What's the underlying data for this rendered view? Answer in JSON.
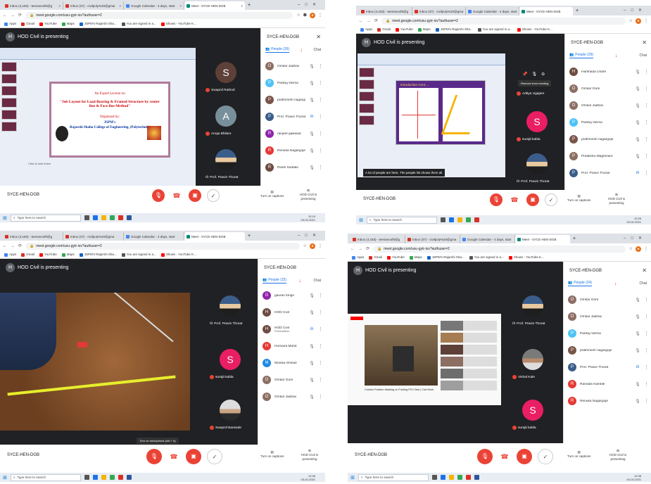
{
  "quadrants": [
    {
      "tabs": [
        "Inbox (4,183) - teenanoof5@g",
        "Inbox (37) - civilpoly%20@gmai",
        "Google Calendar - 4 days, start",
        "Meet - SYCE-HEN-DGB"
      ],
      "url": "meet.google.com/uxu-gytr-isv?authuser=2",
      "bookmarks": [
        "Apps",
        "Gmail",
        "YouTube",
        "Maps",
        "JSPM's Rajarshi Sha...",
        "You are signed in a...",
        "Shows - YouTube K..."
      ],
      "presenting": "HOD Civil is presenting",
      "presenter_initial": "H",
      "meeting_name": "SYCE-HEN-DGB",
      "people_count": "People (26)",
      "slide": {
        "line1": "An Expert Lecture on",
        "line2": "\"Job Layout for Load Bearing & Framed Structure by center line & Face line Method\"",
        "line3": "Organized by:",
        "line4": "JSPM's",
        "line5": "Rajarshi Shahu College of Engineering, (Polytechnic)",
        "notes": "Click to add notes"
      },
      "tiles": [
        {
          "initial": "S",
          "name": "Swapnil Rathod",
          "color": "#5d4037"
        },
        {
          "initial": "A",
          "name": "Anuja Bhilare",
          "color": "#78909c"
        },
        {
          "initial": "",
          "name": "Prof. Pravin Thorat",
          "color": "#3b5d8a"
        }
      ],
      "participants": [
        {
          "initial": "O",
          "name": "Omkar Jadhav",
          "color": "#8d6e63",
          "active": false
        },
        {
          "initial": "P",
          "name": "Pankaj Varma",
          "color": "#4fc3f7",
          "active": false
        },
        {
          "initial": "P",
          "name": "prathmesh nagargoje",
          "color": "#795548",
          "active": false
        },
        {
          "initial": "P",
          "name": "Prof. Pravin Thorat",
          "color": "#3b5d8a",
          "active": true
        },
        {
          "initial": "R",
          "name": "ranjeet gaikwad",
          "color": "#8e24aa",
          "active": false
        },
        {
          "initial": "R",
          "name": "Renuka Nagargoje",
          "color": "#e53935",
          "active": false
        },
        {
          "initial": "R",
          "name": "Rushi Sudake",
          "color": "#6d4c41",
          "active": false
        }
      ],
      "taskbar_search": "Type here to search",
      "clock": [
        "12:19",
        "03-02-2021"
      ]
    },
    {
      "tabs": [
        "Inbox (4,183) - teenanoof5@g",
        "Inbox (37) - civilpoly%20@gma",
        "Google Calendar - 4 days, start",
        "Meet - SYCE-HEN-DGB"
      ],
      "url": "meet.google.com/uxu-gytr-isv?authuser=2",
      "bookmarks": [
        "Apps",
        "Gmail",
        "YouTube",
        "Maps",
        "JSPM's Rajarshi Sha...",
        "You are signed in a...",
        "Shows - YouTube K..."
      ],
      "presenting": "HOD Civil is presenting",
      "presenter_initial": "H",
      "meeting_name": "SYCE-HEN-DGB",
      "people_count": "People (29)",
      "slide": {
        "title": "Introduction Cont...."
      },
      "overlay_text": "A lot of people are here. The people list shows them all.",
      "tooltip": "Remove from meeting",
      "tiles": [
        {
          "initial": "",
          "name": "Aditya Ugajare",
          "color": "#9e9e9e"
        },
        {
          "initial": "S",
          "name": "surajit kabla",
          "color": "#e91e63"
        },
        {
          "initial": "",
          "name": "Prof. Pravin Thorat",
          "color": "#3b5d8a"
        }
      ],
      "participants": [
        {
          "initial": "H",
          "name": "Harshada Undre",
          "color": "#6d4c41",
          "active": false
        },
        {
          "initial": "O",
          "name": "Omkar Gore",
          "color": "#8d6e63",
          "active": false
        },
        {
          "initial": "O",
          "name": "Omkar Jadhav",
          "color": "#8d6e63",
          "active": false
        },
        {
          "initial": "P",
          "name": "Pankaj Varma",
          "color": "#4fc3f7",
          "active": false
        },
        {
          "initial": "P",
          "name": "prathmesh nagargoje",
          "color": "#795548",
          "active": false
        },
        {
          "initial": "P",
          "name": "Pratiksha Waghmare",
          "color": "#8d6e63",
          "active": false
        },
        {
          "initial": "P",
          "name": "Prof. Pravin Thorat",
          "color": "#3b5d8a",
          "active": true
        }
      ],
      "taskbar_search": "Type here to search",
      "clock": [
        "12:26",
        "03-02-2021"
      ]
    },
    {
      "tabs": [
        "Inbox (4,183) - teenanoof5@g",
        "Inbox (37) - civilpoly%20@gma",
        "Google Calendar - 4 days, start",
        "Meet - SYCE-HEN-DGB"
      ],
      "url": "meet.google.com/uxu-gytr-isv?authuser=2",
      "bookmarks": [
        "Apps",
        "Gmail",
        "YouTube",
        "Maps",
        "JSPM's Rajarshi Sha...",
        "You are signed in a...",
        "Shows - YouTube K..."
      ],
      "presenting": "HOD Civil is presenting",
      "presenter_initial": "H",
      "meeting_name": "SYCE-HEN-DGB",
      "people_count": "People (32)",
      "tooltip": "Turn on microphone (ctrl + d)",
      "tiles": [
        {
          "initial": "",
          "name": "Prof. Pravin Thorat",
          "color": "#3b5d8a"
        },
        {
          "initial": "S",
          "name": "surajit kabla",
          "color": "#e91e63"
        },
        {
          "initial": "",
          "name": "Swapnil Barwade",
          "color": "#9e9e9e"
        }
      ],
      "participants": [
        {
          "initial": "G",
          "name": "gaurav tonge",
          "color": "#8e24aa",
          "active": false
        },
        {
          "initial": "H",
          "name": "HOD Civil",
          "color": "#6d4c41",
          "active": false
        },
        {
          "initial": "H",
          "name": "HOD Civil",
          "sub": "Presentation",
          "color": "#6d4c41",
          "active": true
        },
        {
          "initial": "H",
          "name": "Humaira Mohd",
          "color": "#e53935",
          "active": false
        },
        {
          "initial": "M",
          "name": "Monika Shinde",
          "color": "#1e88e5",
          "active": false
        },
        {
          "initial": "O",
          "name": "Omkar Gore",
          "color": "#8d6e63",
          "active": false
        },
        {
          "initial": "O",
          "name": "Omkar Jadhav",
          "color": "#8d6e63",
          "active": false
        }
      ],
      "taskbar_search": "Type here to search",
      "clock": [
        "12:36",
        "03-02-2021"
      ]
    },
    {
      "tabs": [
        "Inbox (4,183) - teenanoof5@g",
        "Inbox (37) - civilpoly%20@gma",
        "Google Calendar - 4 days, start",
        "Meet - SYCE-HEN-DGB"
      ],
      "url": "meet.google.com/uxu-gytr-isv?authuser=2",
      "bookmarks": [
        "Apps",
        "Gmail",
        "YouTube",
        "Maps",
        "JSPM's Rajarshi Sha...",
        "You are signed in a...",
        "Shows - YouTube K..."
      ],
      "presenting": "HOD Civil is presenting",
      "presenter_initial": "H",
      "meeting_name": "SYCE-HEN-DGB",
      "people_count": "People (24)",
      "yt_caption": "Column Position Marking on Footing PCC Bed | Civil Work",
      "tiles": [
        {
          "initial": "",
          "name": "Prof. Pravin Thorat",
          "color": "#3b5d8a"
        },
        {
          "initial": "",
          "name": "Vishal Kale",
          "color": "#9e9e9e"
        },
        {
          "initial": "S",
          "name": "surajit kabla",
          "color": "#e91e63"
        }
      ],
      "participants": [
        {
          "initial": "O",
          "name": "Omkar Gore",
          "color": "#8d6e63",
          "active": false
        },
        {
          "initial": "O",
          "name": "Omkar Jadhav",
          "color": "#8d6e63",
          "active": false
        },
        {
          "initial": "P",
          "name": "Pankaj Varma",
          "color": "#4fc3f7",
          "active": false
        },
        {
          "initial": "P",
          "name": "prathmesh nagargoje",
          "color": "#795548",
          "active": false
        },
        {
          "initial": "P",
          "name": "Prof. Pravin Thorat",
          "color": "#3b5d8a",
          "active": true
        },
        {
          "initial": "R",
          "name": "Ramdas Kamble",
          "color": "#e53935",
          "active": false
        },
        {
          "initial": "R",
          "name": "Renuka Nagargoje",
          "color": "#e53935",
          "active": false
        }
      ],
      "taskbar_search": "Type here to search",
      "clock": [
        "12:38",
        "03-02-2021"
      ]
    }
  ],
  "controls": {
    "chat_label": "Chat",
    "captions_label": "Turn on captions",
    "presenting_label": "HOD Civil is presenting",
    "close_glyph": "×",
    "search_glyph": "⌕"
  },
  "colors": {
    "meet_red": "#ea4335",
    "meet_blue": "#1a73e8",
    "stage_bg": "#202124"
  }
}
